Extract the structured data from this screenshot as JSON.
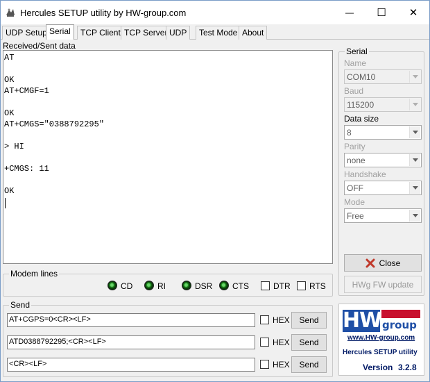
{
  "window": {
    "title": "Hercules SETUP utility by HW-group.com",
    "controls": {
      "minimize": "—",
      "maximize": "☐",
      "close": "✕"
    }
  },
  "tabs": [
    {
      "label": "UDP Setup",
      "active": false
    },
    {
      "label": "Serial",
      "active": true
    },
    {
      "label": "TCP Client",
      "active": false
    },
    {
      "label": "TCP Server",
      "active": false
    },
    {
      "label": "UDP",
      "active": false
    },
    {
      "label": "Test Mode",
      "active": false
    },
    {
      "label": "About",
      "active": false
    }
  ],
  "received": {
    "label": "Received/Sent data",
    "lines": [
      "AT",
      "",
      "OK",
      "AT+CMGF=1",
      "",
      "OK",
      "AT+CMGS=\"0388792295\"",
      "",
      "> HI",
      "",
      "+CMGS: 11",
      "",
      "OK"
    ]
  },
  "serial": {
    "title": "Serial",
    "name_label": "Name",
    "name_value": "COM10",
    "baud_label": "Baud",
    "baud_value": "115200",
    "datasize_label": "Data size",
    "datasize_value": "8",
    "parity_label": "Parity",
    "parity_value": "none",
    "handshake_label": "Handshake",
    "handshake_value": "OFF",
    "mode_label": "Mode",
    "mode_value": "Free",
    "close_label": "Close",
    "fw_update_label": "HWg FW update"
  },
  "modem": {
    "title": "Modem lines",
    "leds": [
      "CD",
      "RI",
      "DSR",
      "CTS"
    ],
    "outputs": [
      "DTR",
      "RTS"
    ]
  },
  "send": {
    "title": "Send",
    "rows": [
      {
        "value": "AT+CGPS=0<CR><LF>",
        "hex_label": "HEX",
        "send_label": "Send"
      },
      {
        "value": "ATD0388792295;<CR><LF>",
        "hex_label": "HEX",
        "send_label": "Send"
      },
      {
        "value": "<CR><LF>",
        "hex_label": "HEX",
        "send_label": "Send"
      }
    ]
  },
  "logo": {
    "brand": "HW",
    "brand_suffix": "group",
    "url": "www.HW-group.com",
    "product": "Hercules SETUP utility",
    "version_label": "Version",
    "version": "3.2.8"
  },
  "colors": {
    "logo_blue": "#1f4fa6",
    "logo_red": "#c8102e",
    "close_x_red": "#c0392b",
    "version_navy": "#001a66"
  }
}
